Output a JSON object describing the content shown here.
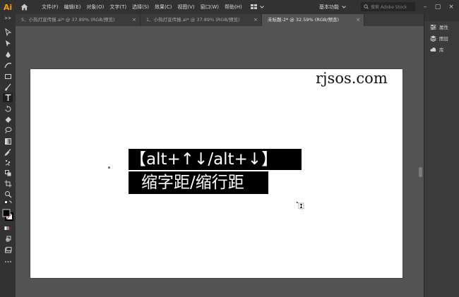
{
  "app": {
    "logo": "Ai"
  },
  "menubar": {
    "items": [
      "文件(F)",
      "编辑(E)",
      "对象(O)",
      "文字(T)",
      "选择(S)",
      "效果(C)",
      "视图(V)",
      "窗口(W)",
      "帮助(H)"
    ],
    "workspace": "基本功能",
    "search_placeholder": "搜索 Adobe Stock"
  },
  "tabs": [
    {
      "label": "5、小热灯宣传报.ai* @ 37.89% (RGB/预览)",
      "active": false
    },
    {
      "label": "1、小热灯宣传报.ai* @ 37.89% (RGB/预览)",
      "active": false
    },
    {
      "label": "未标题-2* @ 32.59% (RGB/预览)",
      "active": true
    }
  ],
  "panel": {
    "items": [
      "属性",
      "图层",
      "库"
    ]
  },
  "canvas": {
    "watermark": "rjsos.com",
    "line1": "【alt+↑↓/alt+↓】",
    "line2": "缩字距/缩行距"
  },
  "colors": {
    "menubar_bg": "#323232",
    "workspace_bg": "#535353",
    "logo": "#ff9a00",
    "highlight_bg": "#000000"
  }
}
